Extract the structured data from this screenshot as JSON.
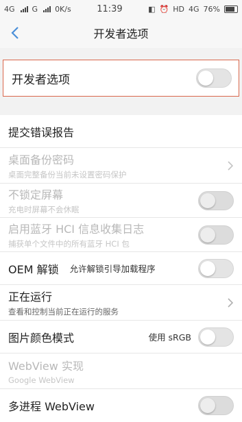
{
  "status_bar": {
    "carrier1": "4G",
    "carrier2": "G",
    "speed": "0K/s",
    "time": "11:39",
    "hd": "HD",
    "network": "4G",
    "battery_percent": "76%"
  },
  "header": {
    "title": "开发者选项"
  },
  "master": {
    "label": "开发者选项",
    "enabled": false
  },
  "rows": {
    "bug_report": {
      "title": "提交错误报告"
    },
    "backup_password": {
      "title": "桌面备份密码",
      "subtitle": "桌面完整备份当前未设置密码保护"
    },
    "stay_awake": {
      "title": "不锁定屏幕",
      "subtitle": "充电时屏幕不会休眠"
    },
    "hci_log": {
      "title": "启用蓝牙 HCI 信息收集日志",
      "subtitle": "捕获单个文件中的所有蓝牙 HCI 包"
    },
    "oem_unlock": {
      "title": "OEM 解锁",
      "inline": "允许解锁引导加载程序"
    },
    "running_services": {
      "title": "正在运行",
      "subtitle": "查看和控制当前正在运行的服务"
    },
    "color_mode": {
      "title": "图片颜色模式",
      "inline": "使用 sRGB"
    },
    "webview": {
      "title": "WebView 实现",
      "subtitle": "Google WebView"
    },
    "multiprocess_webview": {
      "title": "多进程 WebView"
    }
  },
  "colors": {
    "highlight_border": "#d9664b",
    "background": "#f2f2f2"
  }
}
